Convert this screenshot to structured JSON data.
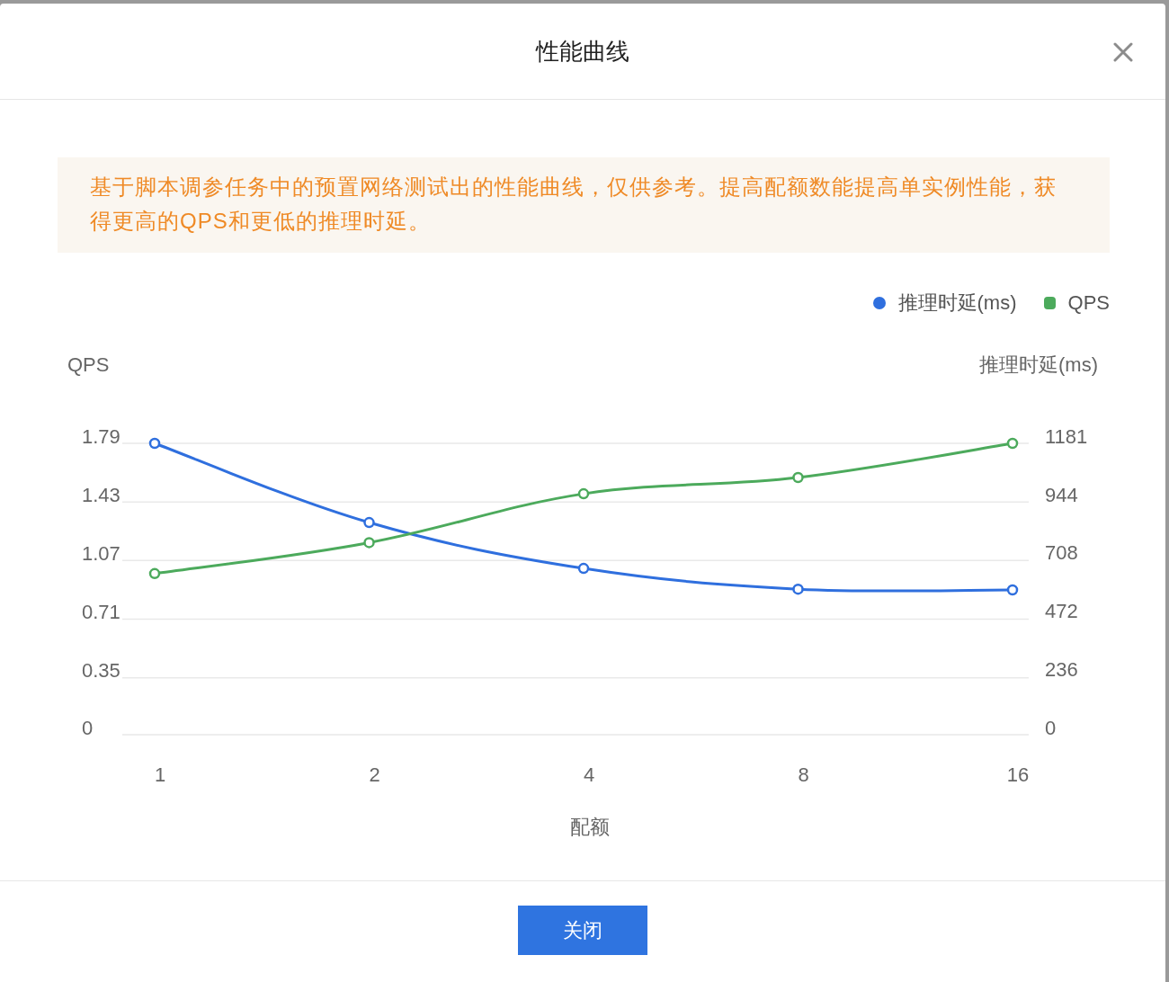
{
  "dialog": {
    "title": "性能曲线"
  },
  "notice": "基于脚本调参任务中的预置网络测试出的性能曲线，仅供参考。提高配额数能提高单实例性能，获得更高的QPS和更低的推理时延。",
  "chart": {
    "chart_data": {
      "type": "line",
      "xlabel": "配额",
      "ylabel": "QPS",
      "y2label": "推理时延(ms)",
      "categories": [
        "1",
        "2",
        "4",
        "8",
        "16"
      ],
      "series": [
        {
          "name": "推理时延(ms)",
          "color": "#2f6fde",
          "axis": "y2",
          "marker": "circle",
          "values": [
            1181,
            860,
            674,
            590,
            587
          ]
        },
        {
          "name": "QPS",
          "color": "#4caa5c",
          "marker": "circle",
          "values": [
            0.99,
            1.18,
            1.48,
            1.58,
            1.79
          ]
        }
      ],
      "grid": true,
      "legend": "top-right",
      "ylim": [
        0,
        1.79
      ],
      "y2lim": [
        0,
        1181
      ],
      "yticks": [
        0,
        0.35,
        0.71,
        1.07,
        1.43,
        1.79
      ],
      "y2ticks": [
        0,
        236,
        472,
        708,
        944,
        1181
      ]
    }
  },
  "buttons": [
    "关闭"
  ]
}
